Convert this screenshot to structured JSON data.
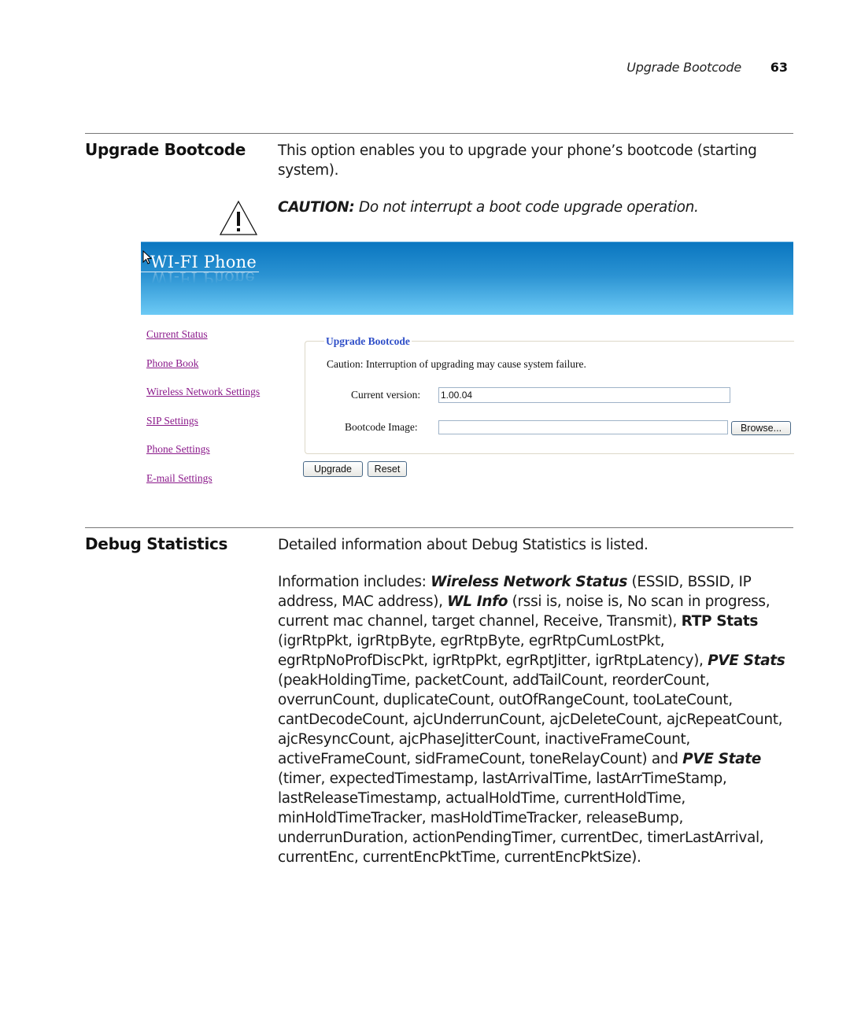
{
  "header": {
    "running_title": "Upgrade Bootcode",
    "page_number": "63"
  },
  "upgrade_section": {
    "heading": "Upgrade Bootcode",
    "description": "This option enables you to upgrade your phone’s bootcode (starting system).",
    "caution_label": "CAUTION:",
    "caution_text": " Do not interrupt a boot code upgrade operation.",
    "warning_icon": "warning-triangle-icon"
  },
  "screenshot": {
    "banner_title": "WI-FI Phone",
    "cursor_icon": "mouse-pointer-icon",
    "nav": [
      {
        "label": "Current Status"
      },
      {
        "label": "Phone Book"
      },
      {
        "label": "Wireless Network Settings"
      },
      {
        "label": "SIP Settings"
      },
      {
        "label": "Phone Settings"
      },
      {
        "label": "E-mail Settings"
      }
    ],
    "colors": {
      "banner_top": "#0a76c0",
      "banner_bottom": "#6dcaf5",
      "nav_link": "#8b1a8b",
      "legend": "#2f4fc8"
    },
    "form": {
      "legend": "Upgrade Bootcode",
      "caution": "Caution: Interruption of upgrading may cause system failure.",
      "current_version_label": "Current version:",
      "current_version_value": "1.00.04",
      "bootcode_image_label": "Bootcode Image:",
      "bootcode_image_value": "",
      "browse_label": "Browse...",
      "upgrade_label": "Upgrade",
      "reset_label": "Reset"
    }
  },
  "debug_section": {
    "heading": "Debug Statistics",
    "description": "Detailed information about Debug Statistics is listed.",
    "info": [
      {
        "text": "Information includes: ",
        "style": "normal"
      },
      {
        "text": "Wireless Network Status",
        "style": "bold-italic"
      },
      {
        "text": " (ESSID, BSSID, IP address, MAC address), ",
        "style": "normal"
      },
      {
        "text": "WL Info",
        "style": "bold-italic"
      },
      {
        "text": " (rssi is, noise is, No scan in progress, current mac channel, target channel, Receive, Transmit), ",
        "style": "normal"
      },
      {
        "text": "RTP Stats",
        "style": "bold"
      },
      {
        "text": " (igrRtpPkt, igrRtpByte, egrRtpByte, egrRtpCumLostPkt, egrRtpNoProfDiscPkt, igrRtpPkt, egrRptJitter, igrRtpLatency), ",
        "style": "normal"
      },
      {
        "text": "PVE Stats",
        "style": "bold-italic"
      },
      {
        "text": " (peakHoldingTime, packetCount, addTailCount, reorderCount, overrunCount, duplicateCount, outOfRangeCount, tooLateCount, cantDecodeCount, ajcUnderrunCount, ajcDeleteCount, ajcRepeatCount, ajcResyncCount, ajcPhaseJitterCount, inactiveFrameCount, activeFrameCount, sidFrameCount, toneRelayCount) and ",
        "style": "normal"
      },
      {
        "text": "PVE State",
        "style": "bold-italic"
      },
      {
        "text": " (timer, expectedTimestamp, lastArrivalTime, lastArrTimeStamp, lastReleaseTimestamp, actualHoldTime, currentHoldTime, minHoldTimeTracker, masHoldTimeTracker, releaseBump, underrunDuration, actionPendingTimer, currentDec, timerLastArrival, currentEnc, currentEncPktTime, currentEncPktSize).",
        "style": "normal"
      }
    ]
  }
}
